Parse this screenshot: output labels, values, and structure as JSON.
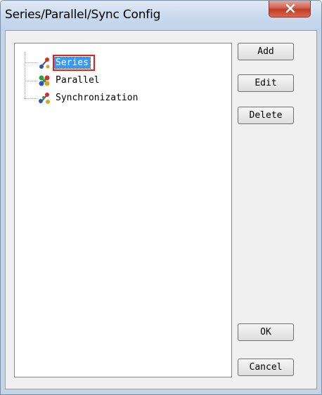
{
  "window": {
    "title": "Series/Parallel/Sync Config",
    "close_icon": "close-icon"
  },
  "tree": {
    "items": [
      {
        "label": "Series",
        "icon": "series-icon",
        "selected": true
      },
      {
        "label": "Parallel",
        "icon": "parallel-icon",
        "selected": false
      },
      {
        "label": "Synchronization",
        "icon": "synchronization-icon",
        "selected": false
      }
    ]
  },
  "buttons": {
    "add": "Add",
    "edit": "Edit",
    "delete": "Delete",
    "ok": "OK",
    "cancel": "Cancel"
  },
  "colors": {
    "selection": "#3399ff",
    "annotation_box": "#e02020",
    "close_button": "#c23b22"
  }
}
